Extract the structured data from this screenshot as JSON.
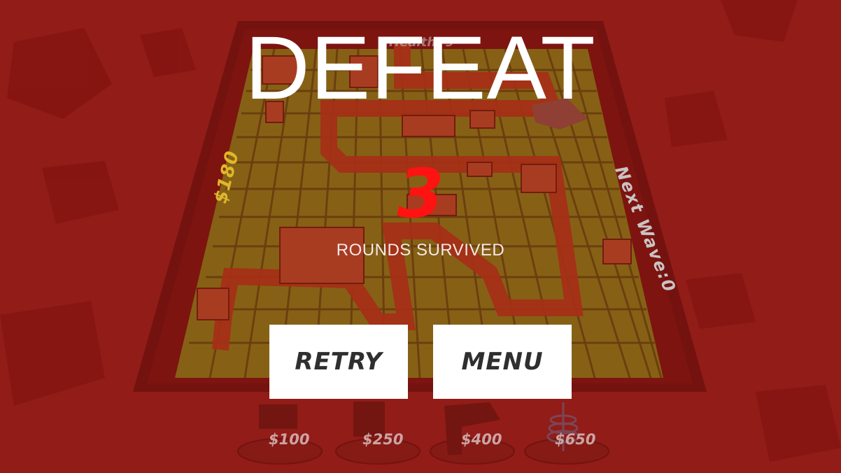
{
  "screen": {
    "title": "DEFEAT",
    "rounds_survived_value": "3",
    "rounds_survived_label": "ROUNDS SURVIVED"
  },
  "buttons": {
    "retry_label": "RETRY",
    "menu_label": "MENU"
  },
  "hud": {
    "money": "$180",
    "next_wave": "Next Wave:0",
    "top_faded": "Health: 9"
  },
  "shop": {
    "items": [
      {
        "price": "$100",
        "icon": "cannon-tower-icon"
      },
      {
        "price": "$250",
        "icon": "mortar-tower-icon"
      },
      {
        "price": "$400",
        "icon": "laser-tower-icon"
      },
      {
        "price": "$650",
        "icon": "tesla-tower-icon"
      }
    ]
  },
  "colors": {
    "tint": "#8f1d1a",
    "rounds_value": "#ff1212",
    "money": "#e0b72a",
    "button_bg": "#ffffff",
    "button_text": "#2f2f2f",
    "grid_green": "#7a9a1a",
    "path_orange": "#b0441c"
  }
}
